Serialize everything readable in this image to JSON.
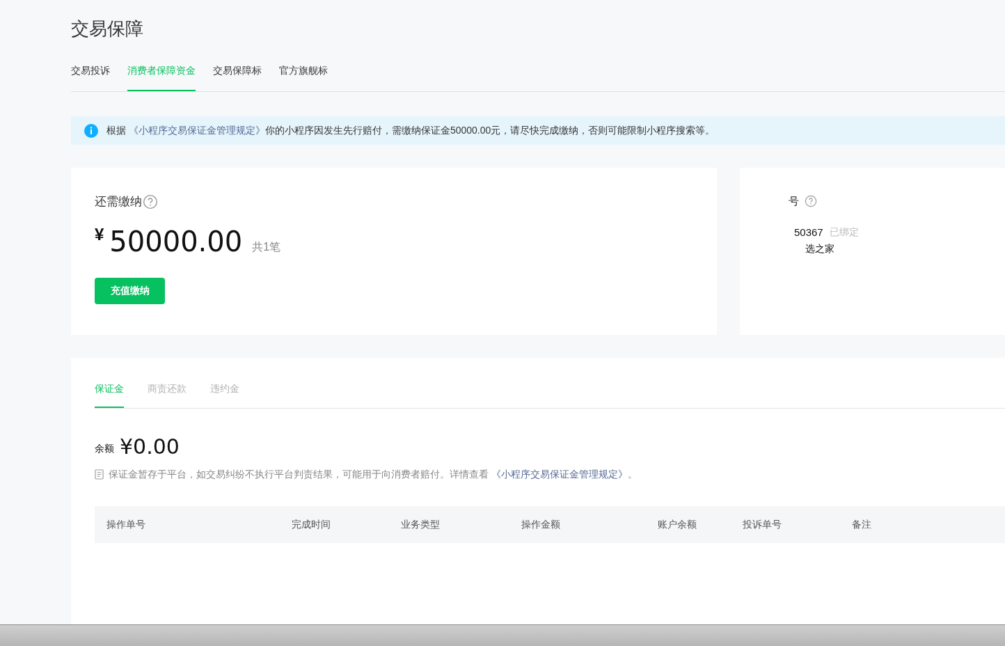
{
  "page_title": "交易保障",
  "tabs": [
    {
      "label": "交易投诉",
      "selected": false
    },
    {
      "label": "消费者保障资金",
      "selected": true
    },
    {
      "label": "交易保障标",
      "selected": false
    },
    {
      "label": "官方旗舰标",
      "selected": false
    }
  ],
  "notice": {
    "before": "根据",
    "link": "《小程序交易保证金管理规定》",
    "after": "你的小程序因发生先行赔付，需缴纳保证金50000.00元，请尽快完成缴纳，否则可能限制小程序搜索等。"
  },
  "due_card": {
    "label": "还需缴纳",
    "currency": "¥",
    "amount": "50000.00",
    "count": "共1笔",
    "button": "充值缴纳"
  },
  "account_card": {
    "label": "号",
    "number": "50367",
    "status": "已绑定",
    "name": "选之家"
  },
  "sub_tabs": [
    {
      "label": "保证金",
      "selected": true
    },
    {
      "label": "商责还款",
      "selected": false
    },
    {
      "label": "违约金",
      "selected": false
    }
  ],
  "balance": {
    "label": "余额",
    "amount": "¥0.00"
  },
  "note": {
    "text": "保证金暂存于平台，如交易纠纷不执行平台判责结果，可能用于向消费者赔付。详情查看",
    "link": "《小程序交易保证金管理规定》",
    "end": "。"
  },
  "table": {
    "columns": [
      "操作单号",
      "完成时间",
      "业务类型",
      "操作金额",
      "账户余额",
      "投诉单号",
      "备注"
    ]
  }
}
